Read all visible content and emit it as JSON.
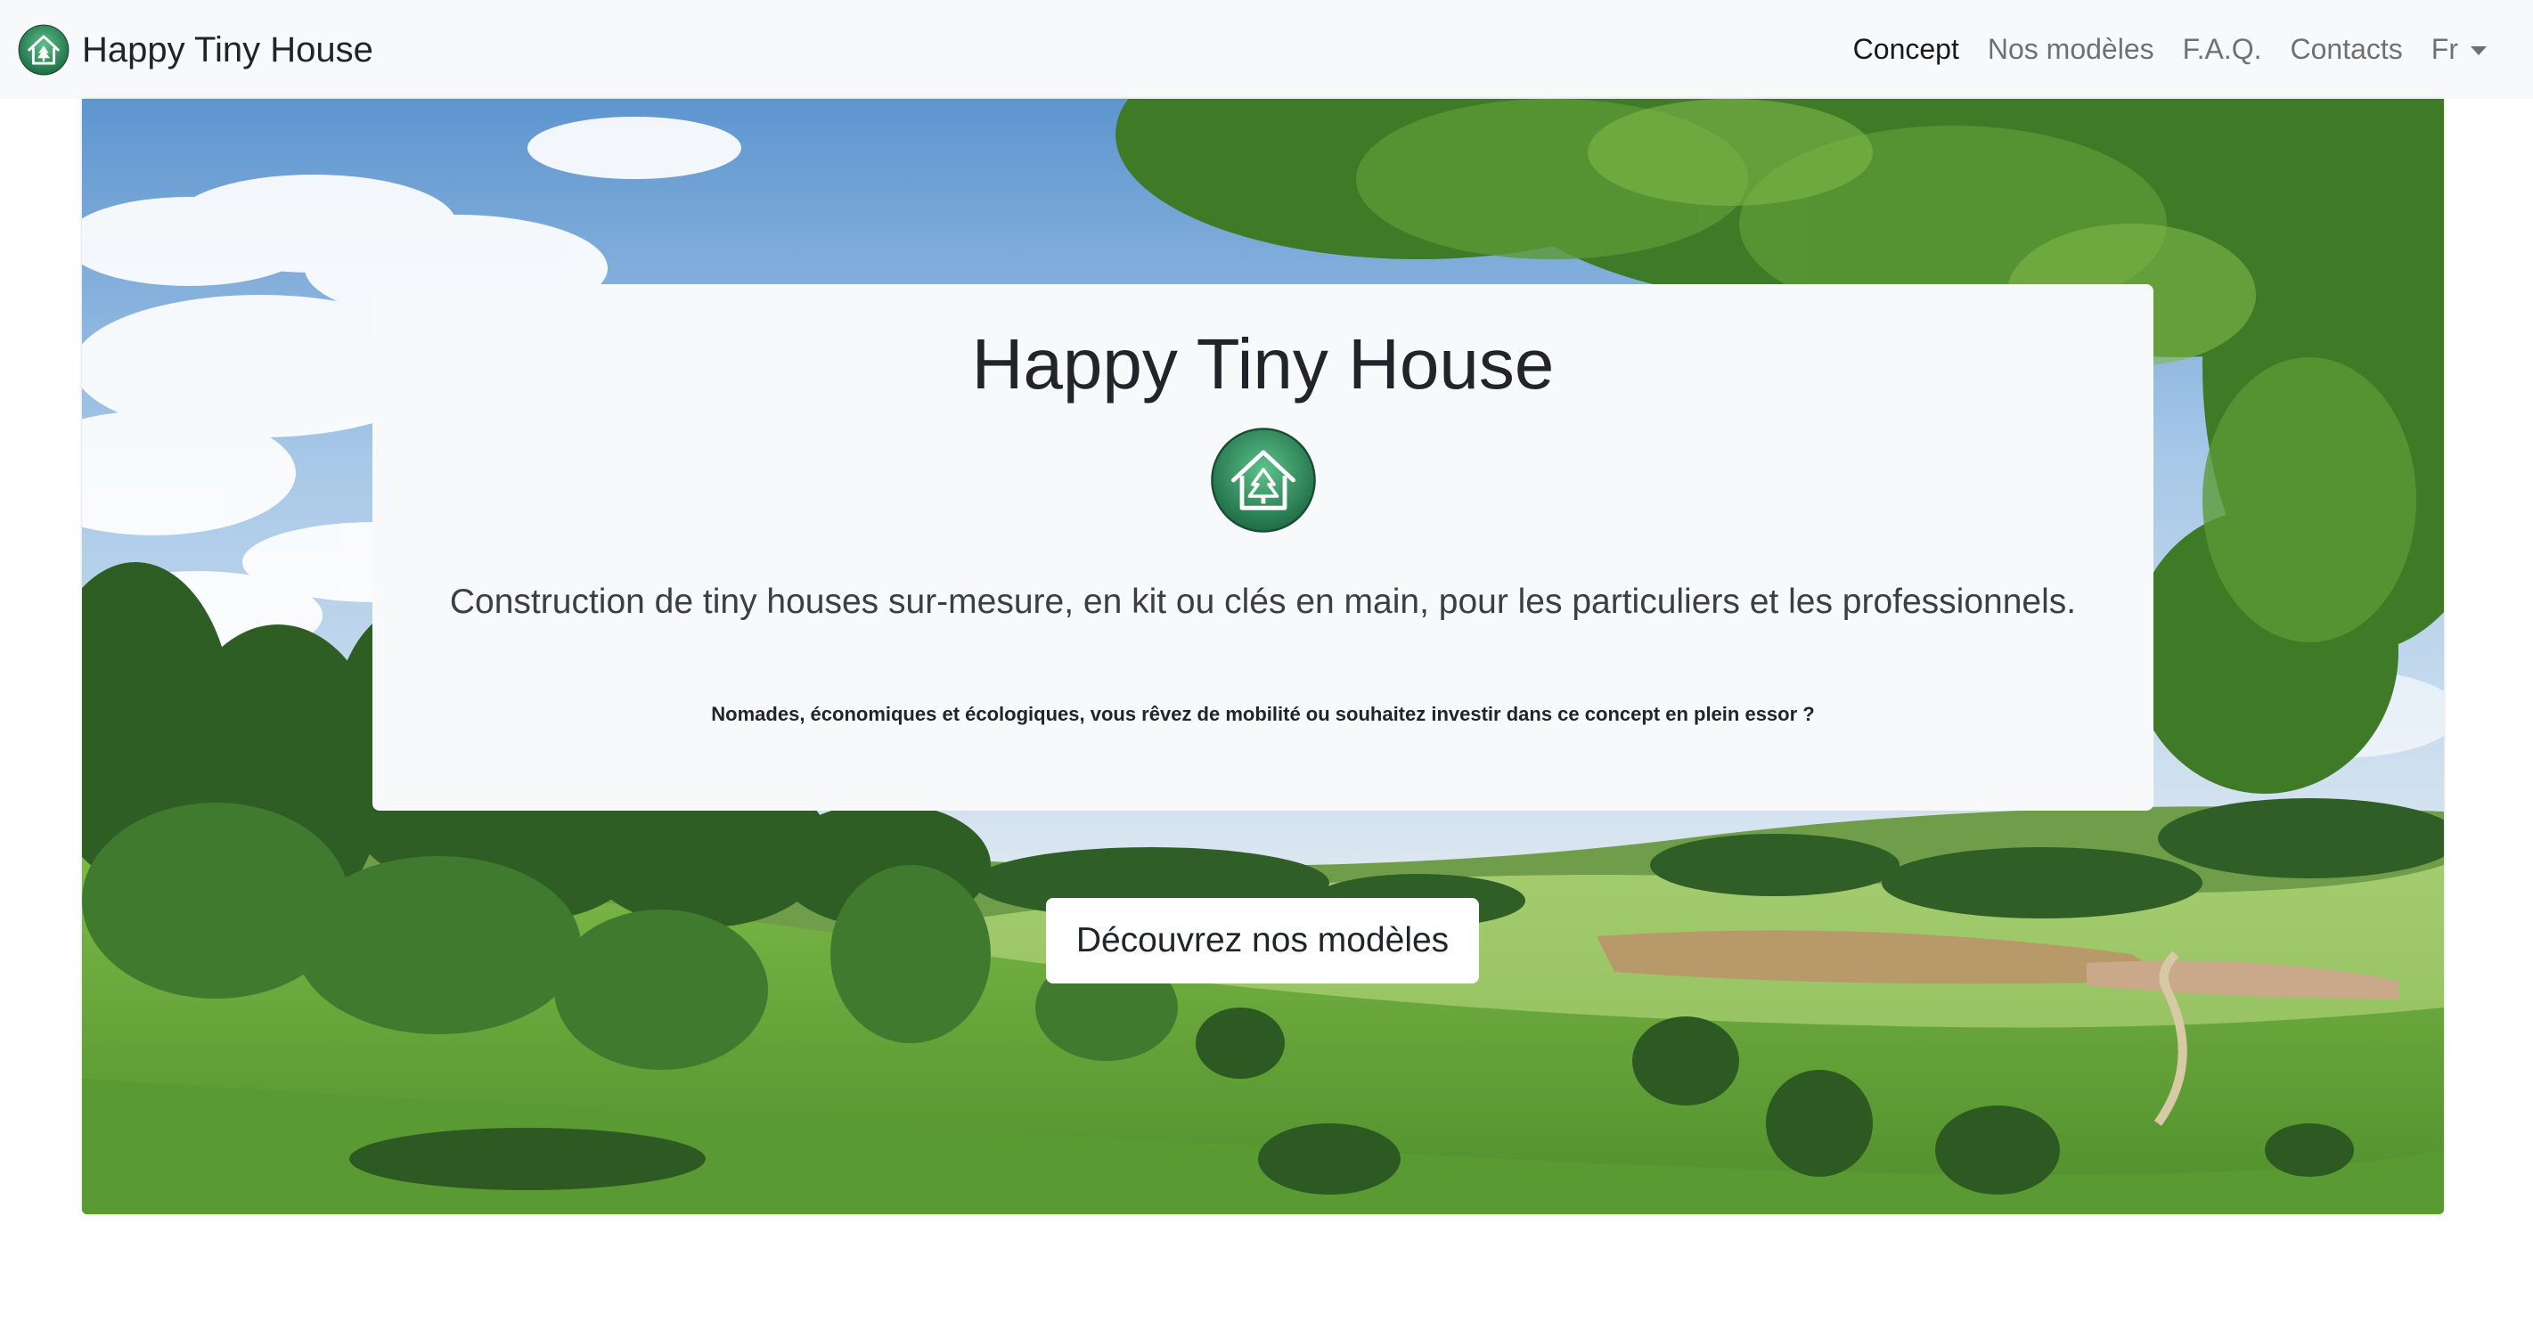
{
  "navbar": {
    "brand": "Happy Tiny House",
    "links": [
      {
        "label": "Concept",
        "active": true
      },
      {
        "label": "Nos modèles",
        "active": false
      },
      {
        "label": "F.A.Q.",
        "active": false
      },
      {
        "label": "Contacts",
        "active": false
      }
    ],
    "language": "Fr"
  },
  "hero": {
    "title": "Happy Tiny House",
    "lead": "Construction de tiny houses sur-mesure, en kit ou clés en main, pour les particuliers et les professionnels.",
    "tagline": "Nomades, économiques et écologiques, vous rêvez de mobilité ou souhaitez investir dans ce concept en plein essor ?",
    "cta_label": "Découvrez nos modèles"
  },
  "icons": {
    "logo": "house-tree-icon",
    "dropdown": "caret-down-icon"
  },
  "colors": {
    "logo_green_dark": "#1f6b45",
    "logo_green_light": "#5cc28a",
    "navbar_bg": "#f8f9fa"
  }
}
